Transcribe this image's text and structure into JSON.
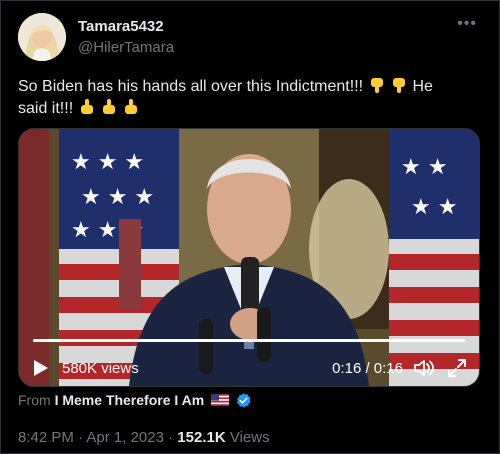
{
  "tweet": {
    "display_name": "Tamara5432",
    "handle": "@HilerTamara",
    "more_icon": "ellipsis-icon",
    "text_line1_a": "So Biden has his hands all over this Indictment!!! ",
    "text_line1_b": "He",
    "text_line2": "said it!!! ",
    "emojis": [
      "point-down-emoji",
      "point-down-emoji",
      "point-up-emoji",
      "point-up-emoji",
      "point-up-emoji"
    ]
  },
  "video": {
    "views_label": "580K views",
    "timecode": "0:16 / 0:16",
    "progress": 1.0,
    "icons": [
      "play-icon",
      "volume-icon",
      "fullscreen-icon"
    ]
  },
  "from": {
    "prefix": "From ",
    "source": "I Meme Therefore I Am",
    "icons": [
      "us-flag-icon",
      "verified-badge-icon"
    ]
  },
  "meta": {
    "time": "8:42 PM",
    "separator1": " · ",
    "date": "Apr 1, 2023",
    "separator2": " · ",
    "views_count": "152.1K",
    "views_suffix": " Views"
  },
  "colors": {
    "background": "#000000",
    "text": "#e7e9ea",
    "secondary": "#71767b",
    "verified": "#1d9bf0",
    "emoji": "#ffcc33"
  }
}
